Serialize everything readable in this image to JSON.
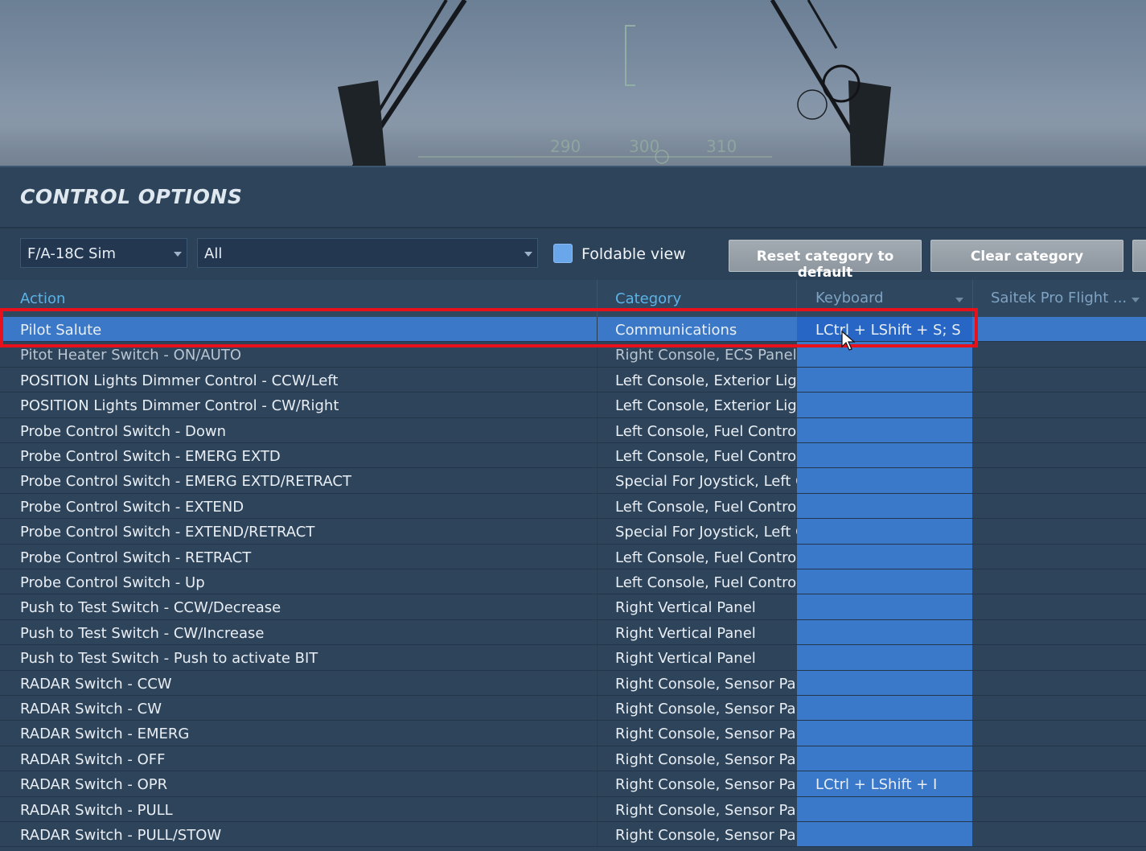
{
  "scene": {
    "hud_ticks": [
      "290",
      "300",
      "310"
    ]
  },
  "panel": {
    "title": "CONTROL OPTIONS"
  },
  "toolbar": {
    "aircraft_value": "F/A-18C Sim",
    "category_value": "All",
    "foldable_label": "Foldable view",
    "foldable_checked": true,
    "reset_label": "Reset category to default",
    "clear_label": "Clear category"
  },
  "table": {
    "headers": {
      "action": "Action",
      "category": "Category",
      "keyboard": "Keyboard",
      "device": "Saitek Pro Flight ..."
    },
    "rows": [
      {
        "action": "Pilot Salute",
        "category": "Communications",
        "keyboard": "LCtrl + LShift + S; S",
        "selected": true
      },
      {
        "action": "Pitot Heater Switch - ON/AUTO",
        "category": "Right Console, ECS Panel",
        "keyboard": ""
      },
      {
        "action": "POSITION Lights Dimmer Control - CCW/Left",
        "category": "Left Console, Exterior Ligl",
        "keyboard": ""
      },
      {
        "action": "POSITION Lights Dimmer Control - CW/Right",
        "category": "Left Console, Exterior Ligl",
        "keyboard": ""
      },
      {
        "action": "Probe Control Switch - Down",
        "category": "Left Console, Fuel Control",
        "keyboard": ""
      },
      {
        "action": "Probe Control Switch - EMERG EXTD",
        "category": "Left Console, Fuel Control",
        "keyboard": ""
      },
      {
        "action": "Probe Control Switch - EMERG EXTD/RETRACT",
        "category": "Special For Joystick, Left C",
        "keyboard": ""
      },
      {
        "action": "Probe Control Switch - EXTEND",
        "category": "Left Console, Fuel Control",
        "keyboard": ""
      },
      {
        "action": "Probe Control Switch - EXTEND/RETRACT",
        "category": "Special For Joystick, Left C",
        "keyboard": ""
      },
      {
        "action": "Probe Control Switch - RETRACT",
        "category": "Left Console, Fuel Control",
        "keyboard": ""
      },
      {
        "action": "Probe Control Switch - Up",
        "category": "Left Console, Fuel Control",
        "keyboard": ""
      },
      {
        "action": "Push to Test Switch - CCW/Decrease",
        "category": "Right Vertical Panel",
        "keyboard": ""
      },
      {
        "action": "Push to Test Switch - CW/Increase",
        "category": "Right Vertical Panel",
        "keyboard": ""
      },
      {
        "action": "Push to Test Switch - Push to activate BIT",
        "category": "Right Vertical Panel",
        "keyboard": ""
      },
      {
        "action": "RADAR Switch - CCW",
        "category": "Right Console, Sensor Pan",
        "keyboard": ""
      },
      {
        "action": "RADAR Switch - CW",
        "category": "Right Console, Sensor Pan",
        "keyboard": ""
      },
      {
        "action": "RADAR Switch - EMERG",
        "category": "Right Console, Sensor Pan",
        "keyboard": ""
      },
      {
        "action": "RADAR Switch - OFF",
        "category": "Right Console, Sensor Pan",
        "keyboard": ""
      },
      {
        "action": "RADAR Switch - OPR",
        "category": "Right Console, Sensor Pan",
        "keyboard": "LCtrl + LShift + I"
      },
      {
        "action": "RADAR Switch - PULL",
        "category": "Right Console, Sensor Pan",
        "keyboard": ""
      },
      {
        "action": "RADAR Switch - PULL/STOW",
        "category": "Right Console, Sensor Pan",
        "keyboard": ""
      }
    ]
  },
  "colors": {
    "accent_header": "#5bb3e6",
    "selected_row": "#3b79c8",
    "keyboard_column": "#3a78c9",
    "annotation_box": "#e8101a"
  }
}
